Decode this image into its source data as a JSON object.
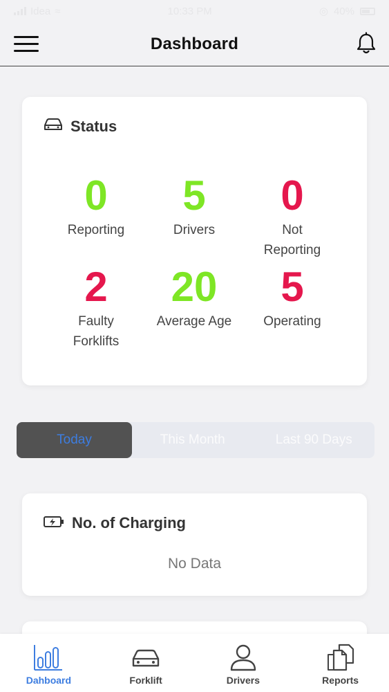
{
  "status_bar": {
    "carrier": "Idea",
    "time": "10:33 PM",
    "battery": "40%"
  },
  "header": {
    "title": "Dashboard",
    "menu_icon": "hamburger-icon",
    "notification_icon": "bell-icon"
  },
  "status_card": {
    "title": "Status",
    "icon": "car-icon",
    "stats": [
      {
        "value": "0",
        "label": "Reporting",
        "color": "#7ee625"
      },
      {
        "value": "5",
        "label": "Drivers",
        "color": "#7ee625"
      },
      {
        "value": "0",
        "label_line1": "Not",
        "label_line2": "Reporting",
        "color": "#e5174d"
      },
      {
        "value": "2",
        "label_line1": "Faulty",
        "label_line2": "Forklifts",
        "color": "#e5174d"
      },
      {
        "value": "20",
        "label": "Average Age",
        "color": "#7ee625"
      },
      {
        "value": "5",
        "label": "Operating",
        "color": "#e5174d"
      }
    ]
  },
  "period_tabs": [
    {
      "label": "Today",
      "active": true
    },
    {
      "label": "This Month",
      "active": false
    },
    {
      "label": "Last 90 Days",
      "active": false
    }
  ],
  "charging_card": {
    "title": "No. of Charging",
    "icon": "battery-charging-icon",
    "empty_text": "No Data"
  },
  "tabbar": [
    {
      "label": "Dahboard",
      "icon": "bar-chart-icon",
      "active": true
    },
    {
      "label": "Forklift",
      "icon": "car-icon",
      "active": false
    },
    {
      "label": "Drivers",
      "icon": "user-icon",
      "active": false
    },
    {
      "label": "Reports",
      "icon": "documents-icon",
      "active": false
    }
  ],
  "colors": {
    "accent": "#3d7de0",
    "good": "#7ee625",
    "bad": "#e5174d",
    "background": "#f2f2f4"
  }
}
